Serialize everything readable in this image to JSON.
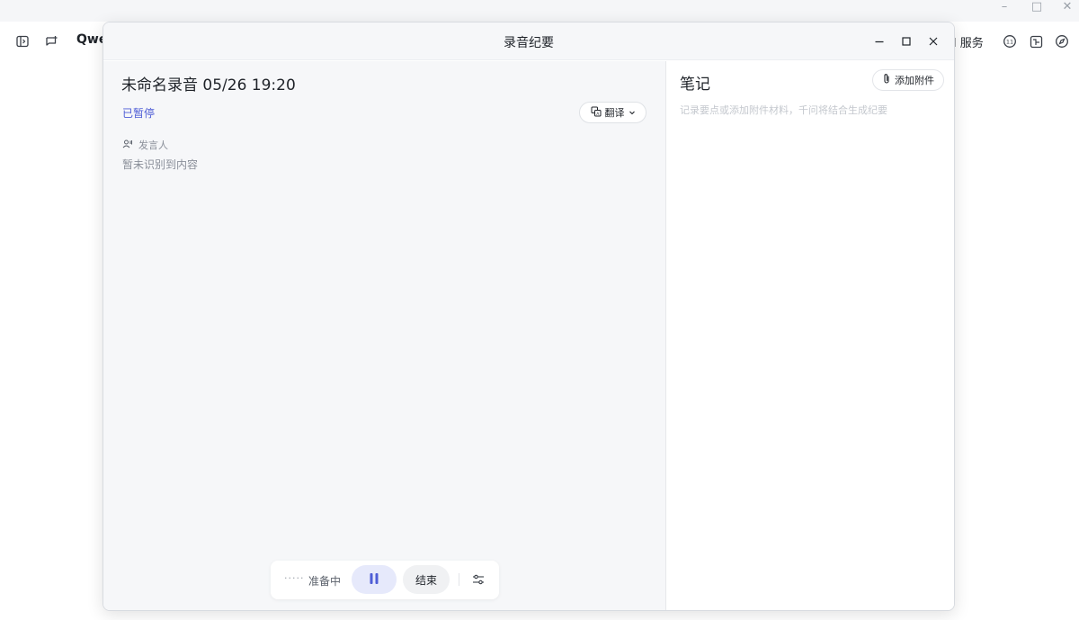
{
  "background_app": {
    "app_name": "Qwe",
    "service_label": "l 服务",
    "window_controls": {
      "minimize": "–",
      "maximize": "□",
      "close": "✕"
    },
    "left_icons": [
      "sidebar-toggle-icon",
      "new-chat-icon"
    ],
    "right_icons": [
      "badge-icon",
      "layout-icon",
      "compass-icon"
    ]
  },
  "modal": {
    "title": "录音纪要",
    "recording": {
      "title": "未命名录音 05/26 19:20",
      "status": "已暂停",
      "translate_label": "翻译",
      "speaker_label": "发言人",
      "empty_hint": "暂未识别到内容"
    },
    "control_bar": {
      "dots": "·····",
      "status": "准备中",
      "end_label": "结束"
    },
    "notes": {
      "title": "笔记",
      "attach_label": "添加附件",
      "placeholder": "记录要点或添加附件材料，千问将结合生成纪要"
    }
  },
  "colors": {
    "accent": "#4e5dd6",
    "pause_bg": "#e6e9fb",
    "pane_bg": "#f6f7f9"
  }
}
